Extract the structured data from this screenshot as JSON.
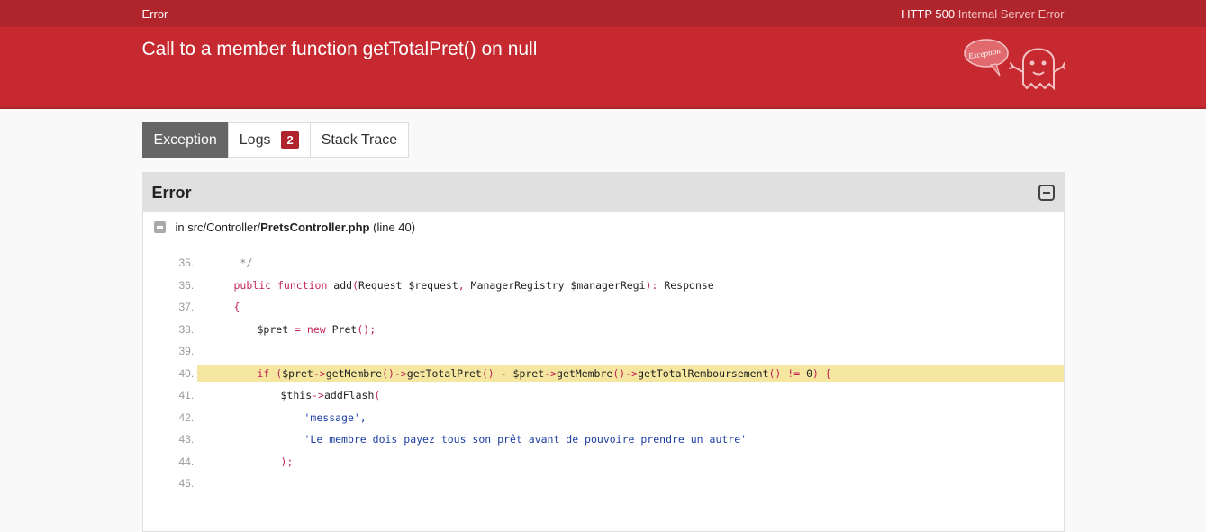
{
  "topbar": {
    "brand": "Error",
    "status_code": "HTTP 500",
    "status_text": "Internal Server Error"
  },
  "header": {
    "message": "Call to a member function getTotalPret() on null",
    "mascot_label": "Exception!"
  },
  "tabs": [
    {
      "label": "Exception",
      "active": true
    },
    {
      "label": "Logs",
      "badge": "2"
    },
    {
      "label": "Stack Trace"
    }
  ],
  "panel": {
    "title": "Error",
    "file_prefix": "in src/Controller/",
    "file_name": "PretsController.php",
    "file_suffix": "(line 40)"
  },
  "code": [
    {
      "num": "35.",
      "indent": 1,
      "text": " */",
      "kind": "comment"
    },
    {
      "num": "36.",
      "indent": 1,
      "text": "public function add(Request $request, ManagerRegistry $managerRegi): Response"
    },
    {
      "num": "37.",
      "indent": 1,
      "text": "{"
    },
    {
      "num": "38.",
      "indent": 2,
      "text": "$pret = new Pret();"
    },
    {
      "num": "39.",
      "indent": 0,
      "text": ""
    },
    {
      "num": "40.",
      "indent": 2,
      "text": "if ($pret->getMembre()->getTotalPret() - $pret->getMembre()->getTotalRemboursement() != 0) {",
      "highlight": true
    },
    {
      "num": "41.",
      "indent": 3,
      "text": "$this->addFlash("
    },
    {
      "num": "42.",
      "indent": 4,
      "text": "'message',",
      "kind": "string"
    },
    {
      "num": "43.",
      "indent": 4,
      "text": "'Le membre dois payez tous son prêt avant de pouvoire prendre un autre'",
      "kind": "string"
    },
    {
      "num": "44.",
      "indent": 3,
      "text": ");"
    },
    {
      "num": "45.",
      "indent": 0,
      "text": ""
    }
  ],
  "colors": {
    "topbar": "#b0242c",
    "header": "#c62a30",
    "highlight": "#f6e7a0"
  }
}
